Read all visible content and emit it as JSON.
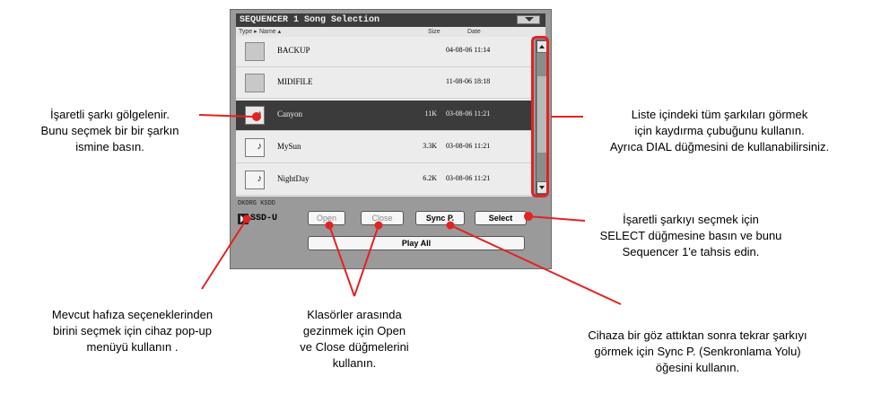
{
  "screen": {
    "title": "SEQUENCER 1 Song Selection",
    "columns": {
      "type": "Type ▸",
      "name": "Name ▴",
      "size": "Size",
      "date": "Date"
    },
    "rows": [
      {
        "kind": "folder",
        "name": "BACKUP",
        "size": "",
        "date": "04-08-06 11:14",
        "selected": false
      },
      {
        "kind": "folder",
        "name": "MIDIFILE",
        "size": "",
        "date": "11-08-06 18:18",
        "selected": false
      },
      {
        "kind": "song",
        "name": "Canyon",
        "size": "11K",
        "date": "03-08-06 11:21",
        "selected": true
      },
      {
        "kind": "song",
        "name": "MySun",
        "size": "3.3K",
        "date": "03-08-06 11:21",
        "selected": false
      },
      {
        "kind": "song",
        "name": "NightDay",
        "size": "6.2K",
        "date": "03-08-06 11:21",
        "selected": false
      }
    ],
    "storage_label": "DKORG KSDD",
    "storage_device": "SSD-U",
    "buttons": {
      "open": "Open",
      "close": "Close",
      "sync": "Sync P.",
      "select": "Select",
      "play_all": "Play All"
    },
    "highlight_color": "#e32222"
  },
  "notes": {
    "left": "İşaretli şarkı gölgelenir.\nBunu seçmek bir bir şarkın\nismine basın.",
    "right_top": "Liste içindeki tüm şarkıları görmek\niçin kaydırma çubuğunu kullanın.\nAyrıca DIAL düğmesini de kullanabilirsiniz.",
    "right_mid": "İşaretli şarkıyı seçmek için\nSELECT düğmesine basın ve bunu\nSequencer 1'e tahsis edin.",
    "bottom_left": "Mevcut hafıza seçeneklerinden\nbirini seçmek için cihaz  pop-up\nmenüyü  kullanın  .",
    "bottom_mid": "Klasörler arasında\ngezinmek için Open\nve Close düğmelerini\nkullanın.",
    "bottom_right": "Cihaza bir göz attıktan sonra tekrar şarkıyı\ngörmek  için Sync P. (Senkronlama Yolu)\nöğesini kullanın."
  }
}
